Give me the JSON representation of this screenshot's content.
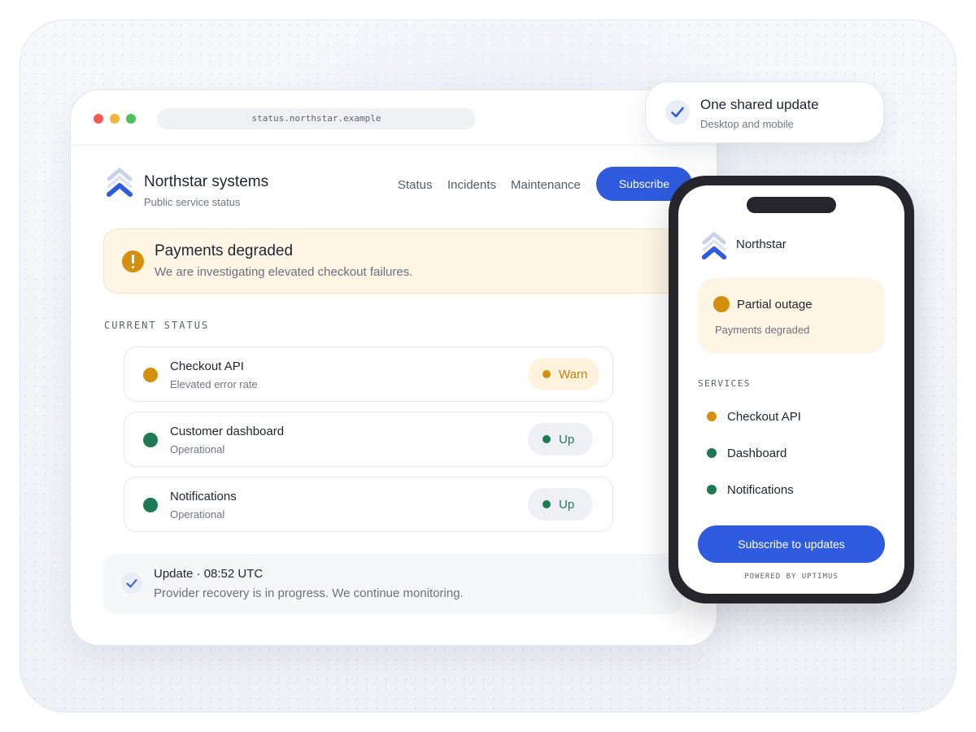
{
  "browser": {
    "url": "status.northstar.example"
  },
  "header": {
    "brand_name": "Northstar systems",
    "brand_subtitle": "Public service status",
    "nav": [
      "Status",
      "Incidents",
      "Maintenance"
    ],
    "subscribe_label": "Subscribe"
  },
  "alert": {
    "title": "Payments degraded",
    "message": "We are investigating elevated checkout failures.",
    "icon": "warning-icon",
    "color": "#d48f0e"
  },
  "current_status": {
    "label": "CURRENT STATUS",
    "services": [
      {
        "name": "Checkout API",
        "description": "Elevated error rate",
        "status": "Warn",
        "color": "#d48f0e"
      },
      {
        "name": "Customer dashboard",
        "description": "Operational",
        "status": "Up",
        "color": "#1c7a55"
      },
      {
        "name": "Notifications",
        "description": "Operational",
        "status": "Up",
        "color": "#1c7a55"
      }
    ]
  },
  "update": {
    "title": "Update · 08:52 UTC",
    "message": "Provider recovery is in progress. We continue monitoring.",
    "icon": "check-icon"
  },
  "toast": {
    "title": "One shared update",
    "subtitle": "Desktop and mobile",
    "icon": "check-icon"
  },
  "mobile": {
    "brand_name": "Northstar",
    "status_card": {
      "title": "Partial outage",
      "subtitle": "Payments degraded",
      "color": "#d48f0e"
    },
    "services_label": "SERVICES",
    "services": [
      {
        "name": "Checkout API",
        "color": "#d48f0e"
      },
      {
        "name": "Dashboard",
        "color": "#1c7a55"
      },
      {
        "name": "Notifications",
        "color": "#1c7a55"
      }
    ],
    "subscribe_label": "Subscribe to updates",
    "powered_by": "POWERED BY UPTIMUS"
  },
  "colors": {
    "accent": "#2f5cde",
    "warning": "#d48f0e",
    "operational": "#1c7a55"
  }
}
